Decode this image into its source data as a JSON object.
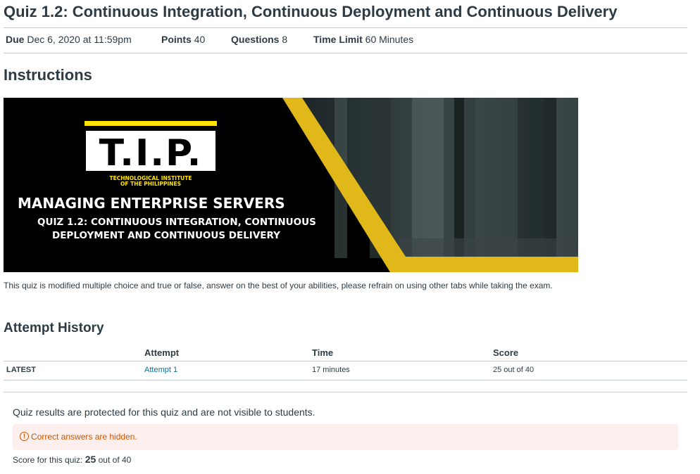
{
  "quiz": {
    "title": "Quiz 1.2: Continuous Integration, Continuous Deployment and Continuous Delivery",
    "due_label": "Due",
    "due_value": "Dec 6, 2020 at 11:59pm",
    "points_label": "Points",
    "points_value": "40",
    "questions_label": "Questions",
    "questions_value": "8",
    "time_limit_label": "Time Limit",
    "time_limit_value": "60 Minutes"
  },
  "instructions": {
    "heading": "Instructions",
    "text": "This quiz is modified multiple choice and true or false, answer on the best of your abilities, please refrain on using other tabs while taking the exam."
  },
  "banner": {
    "logo_text": "T.I.P.",
    "institute_line1": "TECHNOLOGICAL INSTITUTE",
    "institute_line2": "OF THE PHILIPPINES",
    "course_title": "MANAGING ENTERPRISE SERVERS",
    "quiz_line1": "QUIZ 1.2: CONTINUOUS INTEGRATION, CONTINUOUS",
    "quiz_line2": "DEPLOYMENT AND CONTINUOUS DELIVERY",
    "accent_color": "#e0b81a"
  },
  "attempt_history": {
    "heading": "Attempt History",
    "columns": [
      "Attempt",
      "Time",
      "Score"
    ],
    "rows": [
      {
        "label": "LATEST",
        "attempt": "Attempt 1",
        "time": "17 minutes",
        "score": "25 out of 40"
      }
    ]
  },
  "results": {
    "note": "Quiz results are protected for this quiz and are not visible to students.",
    "alert_icon": "!",
    "alert_text": "Correct answers are hidden.",
    "score_prefix": "Score for this quiz: ",
    "score_value": "25",
    "score_suffix": " out of 40"
  },
  "colors": {
    "link": "#0770a3",
    "warning": "#cc5500",
    "alert_bg": "#fcefed"
  }
}
